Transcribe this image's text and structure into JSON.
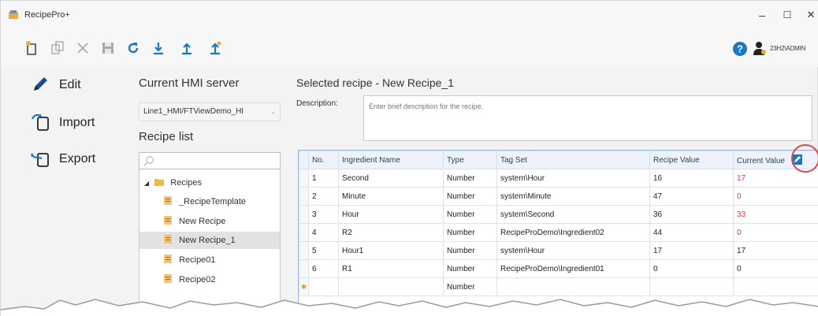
{
  "window": {
    "title": "RecipePro+",
    "controls": {
      "minimize": "–",
      "maximize": "☐",
      "close": "✕"
    }
  },
  "toolbar": {
    "icons": [
      "new-recipe-icon",
      "copy-icon",
      "delete-icon",
      "save-icon",
      "refresh-icon",
      "download-icon",
      "upload-icon",
      "upload-all-icon"
    ],
    "user_label": "23H2\\ADMIN",
    "accent": "#1a78c2"
  },
  "nav": {
    "items": [
      {
        "label": "Edit",
        "icon": "pencil-icon"
      },
      {
        "label": "Import",
        "icon": "import-icon"
      },
      {
        "label": "Export",
        "icon": "export-icon"
      }
    ]
  },
  "recipe_panel": {
    "server_label": "Current HMI server",
    "server_value": "Line1_HMI/FTViewDemo_HI",
    "list_label": "Recipe list",
    "search_placeholder": "",
    "tree": {
      "root": "Recipes",
      "children": [
        "_RecipeTemplate",
        "New Recipe",
        "New Recipe_1",
        "Recipe01",
        "Recipe02"
      ],
      "selected": "New Recipe_1"
    }
  },
  "details": {
    "title": "Selected recipe - New Recipe_1",
    "description_label": "Description:",
    "description_placeholder": "Enter brief description for the recipe.",
    "columns": [
      "No.",
      "Ingredient Name",
      "Type",
      "Tag Set",
      "Recipe Value",
      "Current Value"
    ],
    "rows": [
      {
        "no": "1",
        "name": "Second",
        "type": "Number",
        "tag": "system\\Hour",
        "recipe": "16",
        "current": "17",
        "current_red": true
      },
      {
        "no": "2",
        "name": "Minute",
        "type": "Number",
        "tag": "system\\Minute",
        "recipe": "47",
        "current": "0",
        "current_red": true
      },
      {
        "no": "3",
        "name": "Hour",
        "type": "Number",
        "tag": "system\\Second",
        "recipe": "36",
        "current": "33",
        "current_red": true
      },
      {
        "no": "4",
        "name": "R2",
        "type": "Number",
        "tag": "RecipeProDemo\\Ingredient02",
        "recipe": "44",
        "current": "0",
        "current_red": true
      },
      {
        "no": "5",
        "name": "Hour1",
        "type": "Number",
        "tag": "system\\Hour",
        "recipe": "17",
        "current": "17",
        "current_red": false
      },
      {
        "no": "6",
        "name": "R1",
        "type": "Number",
        "tag": "RecipeProDemo\\Ingredient01",
        "recipe": "0",
        "current": "0",
        "current_red": false
      }
    ],
    "new_row": {
      "marker": "✱",
      "type": "Number"
    },
    "colors": {
      "mismatch": "#e23b3b",
      "highlight": "#e04848"
    }
  }
}
